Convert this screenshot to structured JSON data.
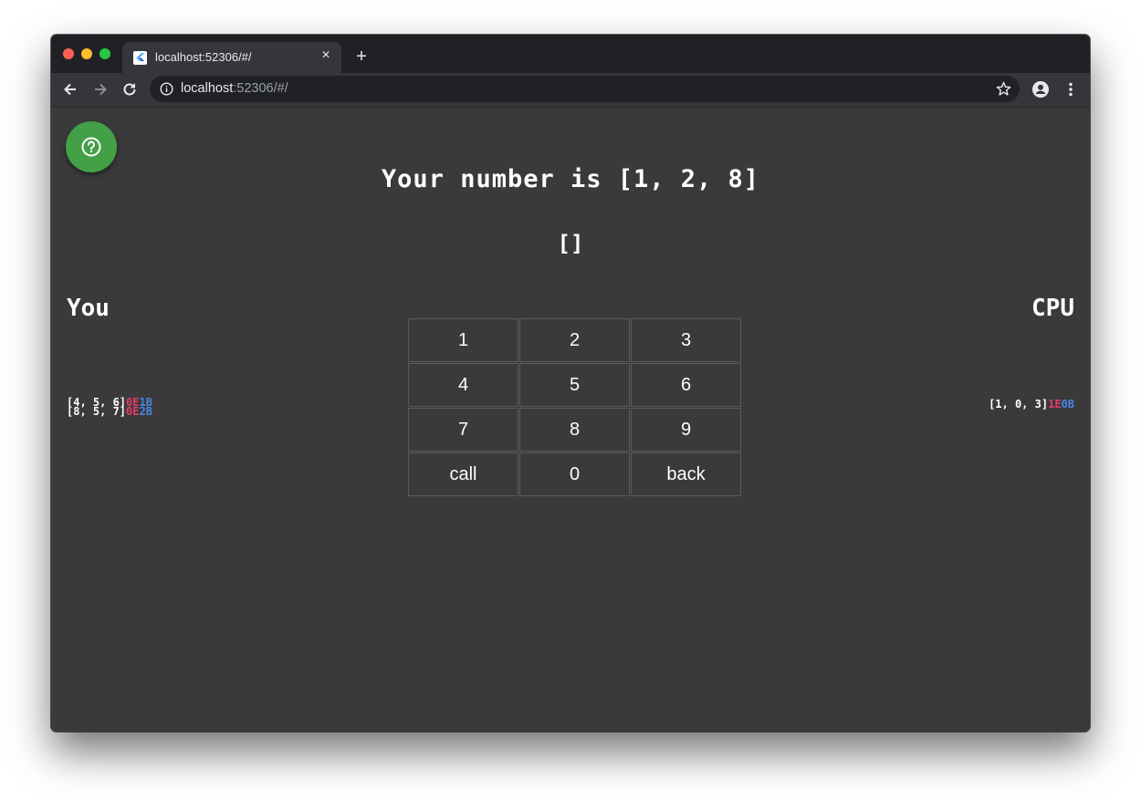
{
  "browser": {
    "tab_title": "localhost:52306/#/",
    "url_host": "localhost",
    "url_rest": ":52306/#/"
  },
  "game": {
    "headline": "Your number is [1, 2, 8]",
    "current_input": "[]",
    "player_label": "You",
    "cpu_label": "CPU",
    "player_history": [
      {
        "guess": "[4, 5, 6]",
        "eat": "0E",
        "bite": "1B"
      },
      {
        "guess": "[8, 5, 7]",
        "eat": "0E",
        "bite": "2B"
      }
    ],
    "cpu_history": [
      {
        "guess": "[1, 0, 3]",
        "eat": "1E",
        "bite": "0B"
      }
    ],
    "keypad": [
      "1",
      "2",
      "3",
      "4",
      "5",
      "6",
      "7",
      "8",
      "9",
      "call",
      "0",
      "back"
    ]
  },
  "colors": {
    "eat": "#e73a6c",
    "bite": "#4a84e8",
    "fab": "#43a047",
    "background": "#3a3a3a"
  },
  "icons": {
    "help_button": "help-circle-icon",
    "favicon": "flutter-logo-icon"
  }
}
